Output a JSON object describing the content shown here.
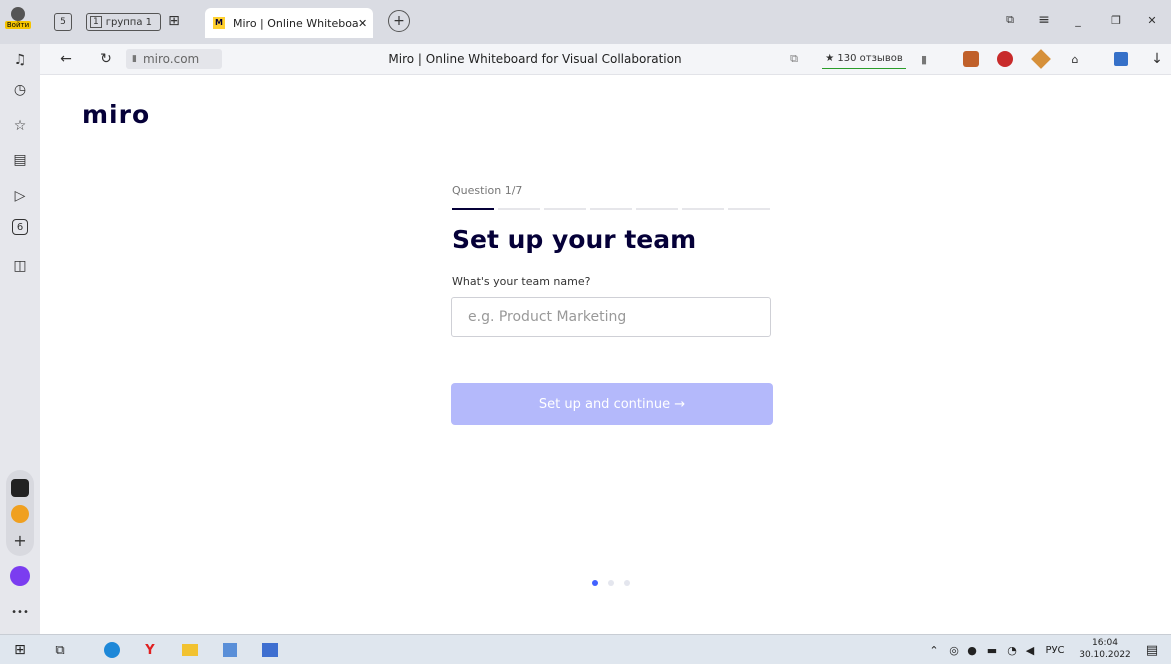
{
  "browser": {
    "login_label": "Войти",
    "tab_count": "5",
    "group_count": "1",
    "group_label": "группа 1",
    "active_tab_title": "Miro | Online Whiteboa",
    "url": "miro.com",
    "page_title": "Miro | Online Whiteboard for Visual Collaboration",
    "reviews": "★ 130 отзывов"
  },
  "main": {
    "logo": "miro",
    "question": "Question 1/7",
    "title": "Set up your team",
    "field_label": "What's your team name?",
    "input_placeholder": "e.g. Product Marketing",
    "input_value": "",
    "submit_label": "Set up and continue →",
    "progress_total": 7,
    "progress_current": 1,
    "pager_active": 1
  },
  "taskbar": {
    "lang": "РУС",
    "time": "16:04",
    "date": "30.10.2022"
  },
  "colors": {
    "brand_dark": "#050038",
    "button_disabled": "#b4b9fb",
    "pager_active": "#4262ff"
  }
}
